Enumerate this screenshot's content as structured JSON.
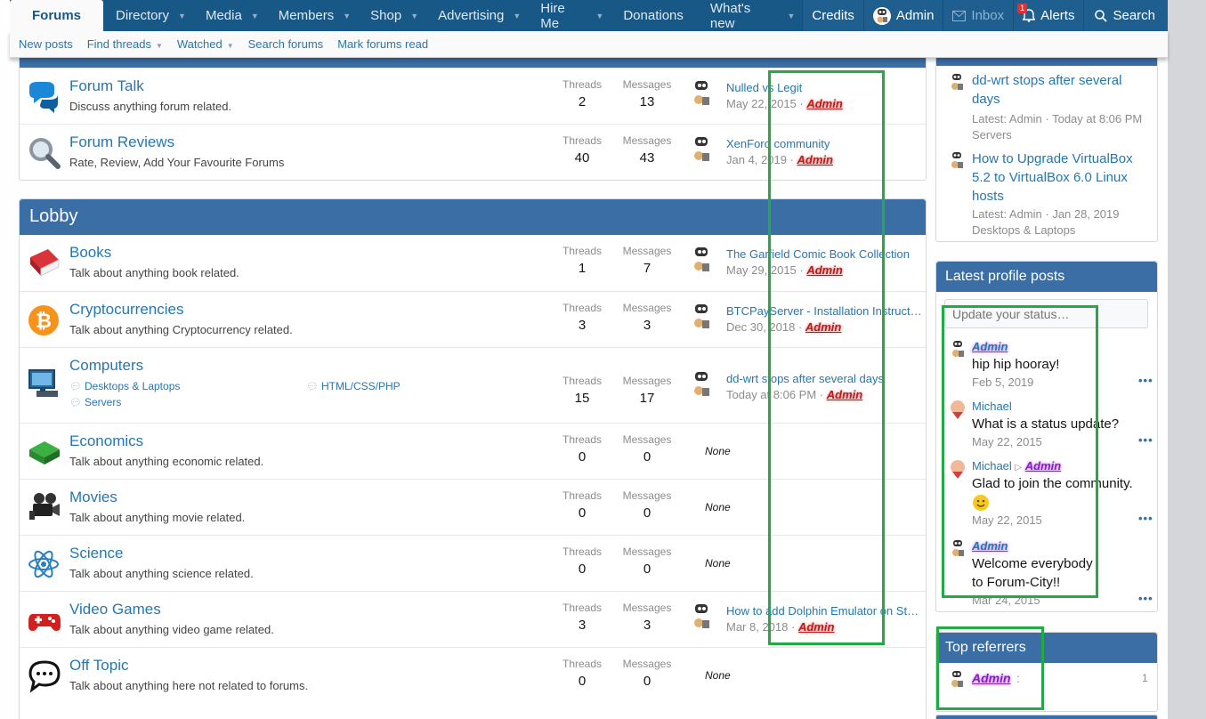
{
  "nav": {
    "tabs": [
      {
        "label": "Forums",
        "active": true,
        "caret": false
      },
      {
        "label": "Directory",
        "caret": true
      },
      {
        "label": "Media",
        "caret": true
      },
      {
        "label": "Members",
        "caret": true
      },
      {
        "label": "Shop",
        "caret": true
      },
      {
        "label": "Advertising",
        "caret": true
      },
      {
        "label": "Hire Me",
        "caret": true
      },
      {
        "label": "Donations",
        "caret": false
      },
      {
        "label": "What's new",
        "caret": true
      }
    ],
    "credits": "Credits",
    "user": "Admin",
    "inbox": "Inbox",
    "alerts": "Alerts",
    "alerts_badge": "1",
    "search": "Search"
  },
  "subnav": {
    "new_posts": "New posts",
    "find_threads": "Find threads",
    "watched": "Watched",
    "search_forums": "Search forums",
    "mark_read": "Mark forums read"
  },
  "labels": {
    "threads": "Threads",
    "messages": "Messages",
    "none": "None"
  },
  "top_forums": [
    {
      "title": "Forum Talk",
      "desc": "Discuss anything forum related.",
      "threads": "2",
      "messages": "13",
      "last_title": "Nulled vs Legit",
      "last_date": "May 22, 2015",
      "last_user": "Admin",
      "icon": "speech-bubbles-icon"
    },
    {
      "title": "Forum Reviews",
      "desc": "Rate, Review, Add Your Favourite Forums",
      "threads": "40",
      "messages": "43",
      "last_title": "XenForo community",
      "last_date": "Jan 4, 2019",
      "last_user": "Admin",
      "icon": "magnifier-icon"
    }
  ],
  "lobby": {
    "title": "Lobby",
    "forums": [
      {
        "title": "Books",
        "desc": "Talk about anything book related.",
        "threads": "1",
        "messages": "7",
        "last_title": "The Garfield Comic Book Collection",
        "last_date": "May 29, 2015",
        "last_user": "Admin",
        "icon": "book-icon"
      },
      {
        "title": "Cryptocurrencies",
        "desc": "Talk about anything Cryptocurrency related.",
        "threads": "3",
        "messages": "3",
        "last_title": "BTCPayServer - Installation Instructions",
        "last_date": "Dec 30, 2018",
        "last_user": "Admin",
        "icon": "bitcoin-icon"
      },
      {
        "title": "Computers",
        "threads": "15",
        "messages": "17",
        "last_title": "dd-wrt stops after several days",
        "last_date": "Today at 8:06 PM",
        "last_user": "Admin",
        "icon": "computer-icon",
        "subforums": [
          "Desktops & Laptops",
          "HTML/CSS/PHP",
          "Servers"
        ]
      },
      {
        "title": "Economics",
        "desc": "Talk about anything economic related.",
        "threads": "0",
        "messages": "0",
        "icon": "money-icon"
      },
      {
        "title": "Movies",
        "desc": "Talk about anything movie related.",
        "threads": "0",
        "messages": "0",
        "icon": "camera-icon"
      },
      {
        "title": "Science",
        "desc": "Talk about anything science related.",
        "threads": "0",
        "messages": "0",
        "icon": "atom-icon"
      },
      {
        "title": "Video Games",
        "desc": "Talk about anything video game related.",
        "threads": "3",
        "messages": "3",
        "last_title": "How to add Dolphin Emulator on Steam",
        "last_date": "Mar 8, 2018",
        "last_user": "Admin",
        "icon": "gamepad-icon"
      },
      {
        "title": "Off Topic",
        "desc": "Talk about anything here not related to forums.",
        "threads": "0",
        "messages": "0",
        "icon": "chat-icon"
      }
    ]
  },
  "sidebar": {
    "threads": [
      {
        "title": "dd-wrt stops after several days",
        "latest": "Latest: Admin · Today at 8:06 PM",
        "forum": "Servers"
      },
      {
        "title": "How to Upgrade VirtualBox 5.2 to VirtualBox 6.0 Linux hosts",
        "latest": "Latest: Admin · Jan 28, 2019",
        "forum": "Desktops & Laptops"
      }
    ],
    "profile_posts": {
      "title": "Latest profile posts",
      "placeholder": "Update your status…",
      "posts": [
        {
          "user": "Admin",
          "msg": "hip hip hooray!",
          "date": "Feb 5, 2019"
        },
        {
          "user": "Michael",
          "msg": "What is a status update?",
          "date": "May 22, 2015"
        },
        {
          "user": "Michael",
          "target": "Admin",
          "msg": "Glad to join the community.",
          "date": "May 22, 2015"
        },
        {
          "user": "Admin",
          "msg": "Welcome everybody to Forum-City!!",
          "date": "Mar 24, 2015"
        }
      ],
      "more": "•••"
    },
    "referrers": {
      "title": "Top referrers",
      "user": "Admin",
      "colon": ":",
      "count": "1"
    }
  },
  "colors": {
    "nav_bg": "#185886",
    "block_head": "#3a6ea5",
    "link": "#2577b1",
    "highlight": "#22aa44"
  }
}
